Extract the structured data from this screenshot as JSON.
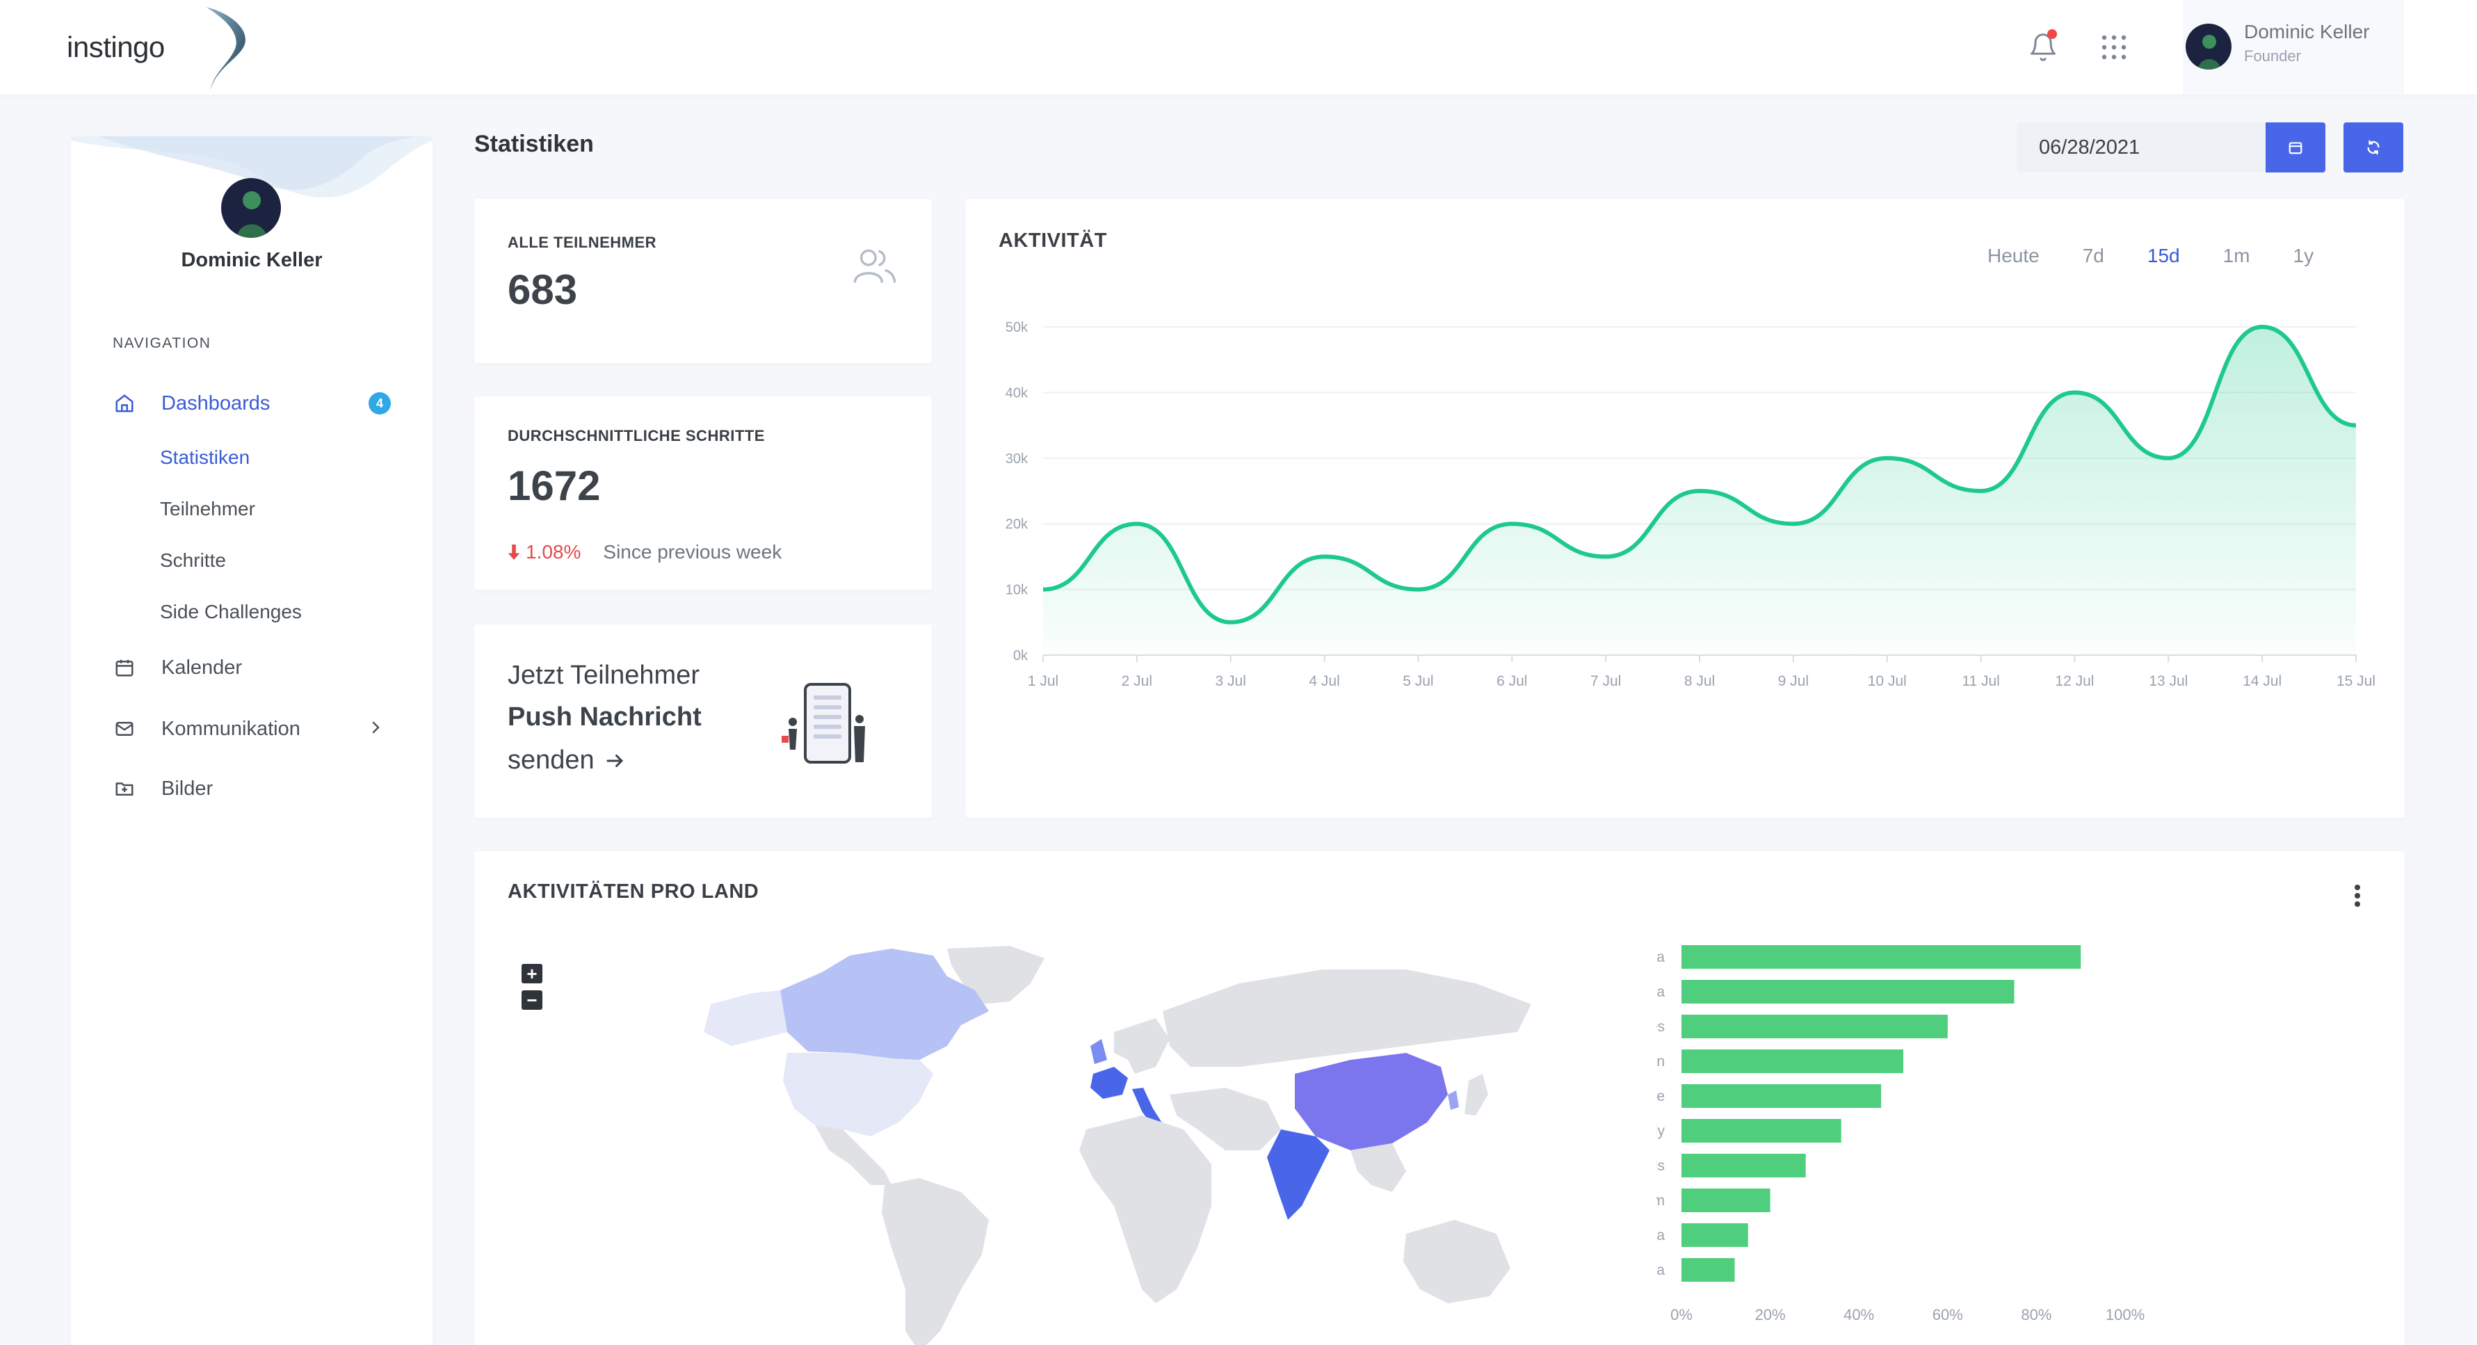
{
  "app": {
    "logo_text": "instingo"
  },
  "header": {
    "user_name": "Dominic Keller",
    "user_role": "Founder",
    "icons": [
      "bell-icon",
      "apps-grid-icon"
    ],
    "notification_color": "#f14646"
  },
  "sidebar": {
    "profile_name": "Dominic Keller",
    "nav_label": "NAVIGATION",
    "items": [
      {
        "label": "Dashboards",
        "icon": "home-icon",
        "badge": "4",
        "active": true
      },
      {
        "label": "Kalender",
        "icon": "calendar-icon"
      },
      {
        "label": "Kommunikation",
        "icon": "mail-icon"
      },
      {
        "label": "Bilder",
        "icon": "folder-image-icon"
      }
    ],
    "subitems": [
      "Statistiken",
      "Teilnehmer",
      "Schritte",
      "Side Challenges"
    ]
  },
  "page": {
    "title": "Statistiken",
    "date_value": "06/28/2021",
    "accent": "#4a66e8"
  },
  "stats": {
    "participants_label": "ALLE TEILNEHMER",
    "participants_value": "683",
    "steps_label": "DURCHSCHNITTLICHE SCHRITTE",
    "steps_value": "1672",
    "trend_pct": "1.08%",
    "trend_note": "Since previous week",
    "trend_color": "#e44b4b"
  },
  "push": {
    "line1": "Jetzt Teilnehmer",
    "line2": "Push Nachricht",
    "line3": "senden"
  },
  "activity": {
    "title": "AKTIVITÄT",
    "tabs": [
      "Heute",
      "7d",
      "15d",
      "1m",
      "1y"
    ],
    "active_tab": "15d"
  },
  "country": {
    "title": "AKTIVITÄTEN PRO LAND"
  },
  "chart_data": [
    {
      "type": "area",
      "title": "AKTIVITÄT",
      "x": [
        "1 Jul",
        "2 Jul",
        "3 Jul",
        "4 Jul",
        "5 Jul",
        "6 Jul",
        "7 Jul",
        "8 Jul",
        "9 Jul",
        "10 Jul",
        "11 Jul",
        "12 Jul",
        "13 Jul",
        "14 Jul",
        "15 Jul"
      ],
      "values": [
        10000,
        20000,
        5000,
        15000,
        10000,
        20000,
        15000,
        25000,
        20000,
        30000,
        25000,
        40000,
        30000,
        50000,
        35000
      ],
      "yticks": [
        "0k",
        "10k",
        "20k",
        "30k",
        "40k",
        "50k"
      ],
      "ylim": [
        0,
        50000
      ],
      "color": "#1ec98c",
      "grid": true
    },
    {
      "type": "bar",
      "orientation": "horizontal",
      "categories": [
        "India",
        "China",
        "United States",
        "Japan",
        "France",
        "Italy",
        "Netherlands",
        "United Kingdom",
        "Canada",
        "South Korea"
      ],
      "values": [
        90,
        75,
        60,
        50,
        45,
        36,
        28,
        20,
        15,
        12
      ],
      "xticks": [
        "0%",
        "20%",
        "40%",
        "60%",
        "80%",
        "100%"
      ],
      "xlim": [
        0,
        100
      ],
      "color": "#4fce7e"
    }
  ]
}
